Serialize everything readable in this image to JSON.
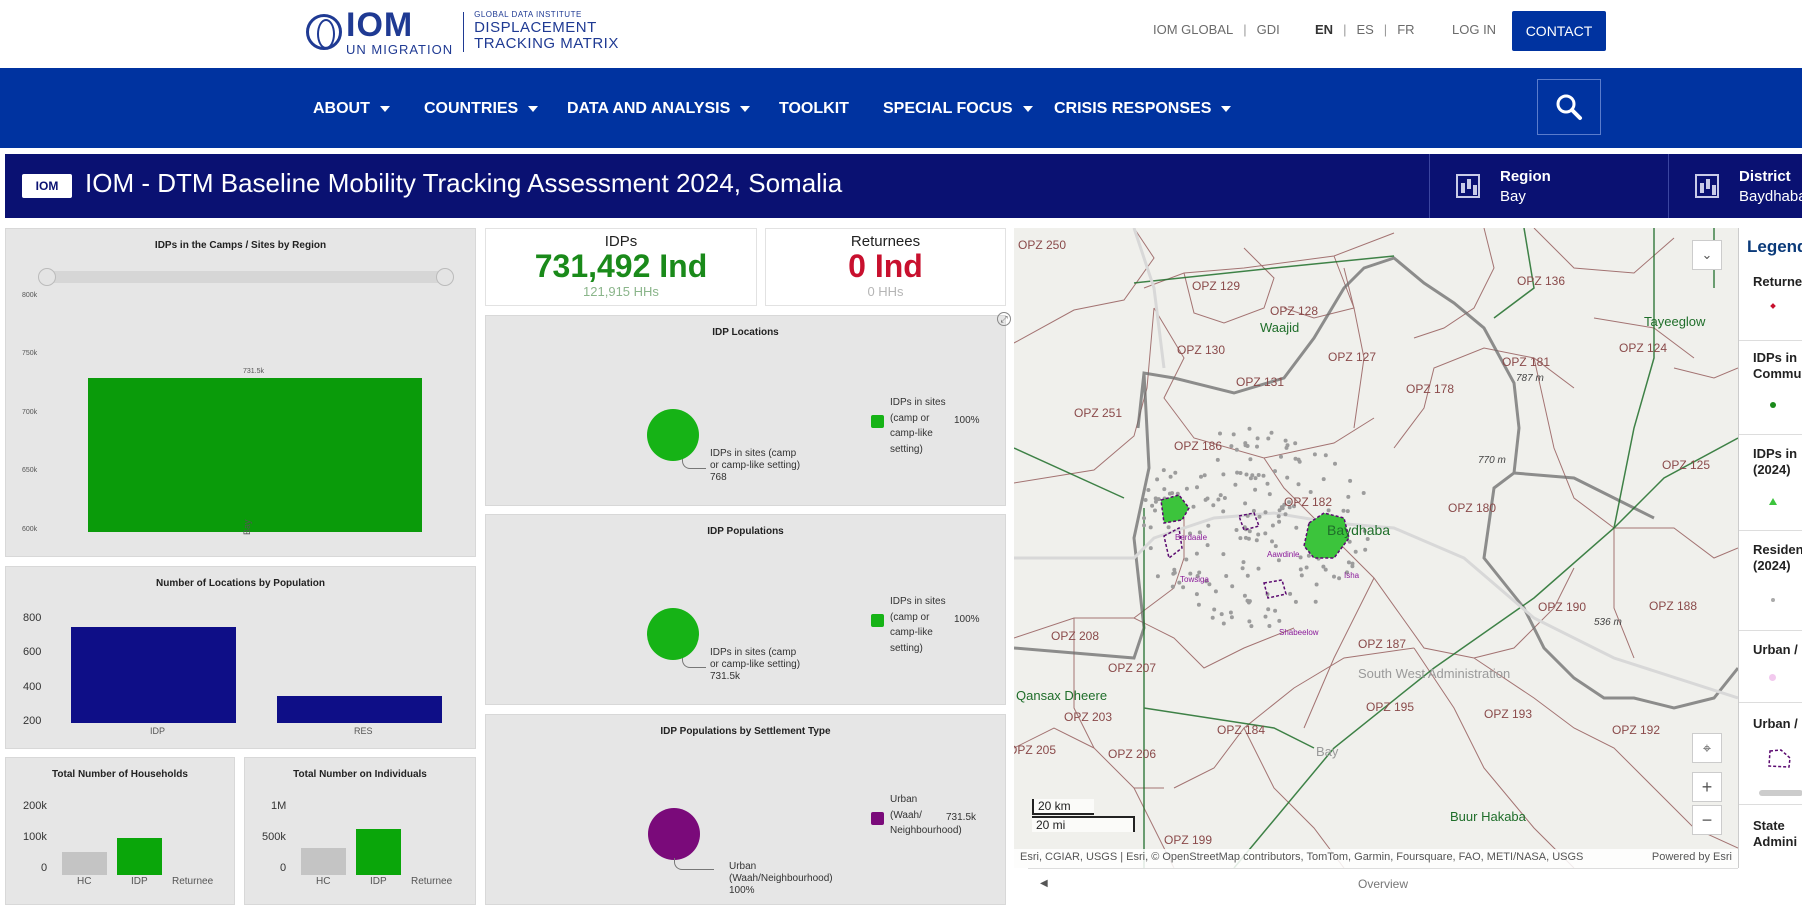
{
  "header": {
    "logo_iom": "IOM",
    "logo_un": "UN MIGRATION",
    "logo_gdi": "GLOBAL DATA INSTITUTE",
    "logo_dtm_line1": "DISPLACEMENT",
    "logo_dtm_line2": "TRACKING MATRIX",
    "links": {
      "iom_global": "IOM GLOBAL",
      "gdi": "GDI",
      "sep": "|"
    },
    "languages": {
      "en": "EN",
      "es": "ES",
      "fr": "FR"
    },
    "login": "LOG IN",
    "contact": "CONTACT"
  },
  "nav": {
    "items": [
      "ABOUT",
      "COUNTRIES",
      "DATA AND ANALYSIS",
      "TOOLKIT",
      "SPECIAL FOCUS",
      "CRISIS RESPONSES"
    ],
    "search_icon": "search-icon"
  },
  "dashboard": {
    "logo": "IOM",
    "title": "IOM - DTM Baseline Mobility Tracking Assessment 2024, Somalia",
    "filters": [
      {
        "label": "Region",
        "value": "Bay"
      },
      {
        "label": "District",
        "value": "Baydhaba"
      }
    ]
  },
  "kpis": {
    "idps": {
      "label": "IDPs",
      "value": "731,492 Ind",
      "sub": "121,915 HHs",
      "color": "#1a8a1a"
    },
    "returnees": {
      "label": "Returnees",
      "value": "0 Ind",
      "sub": "0 HHs",
      "color": "#c8102e"
    }
  },
  "charts": {
    "camps_by_region": {
      "title": "IDPs in the Camps / Sites by Region",
      "type": "bar",
      "categories": [
        "Bay"
      ],
      "values": [
        731.5
      ],
      "data_label": "731.5k",
      "yticks": [
        "800k",
        "750k",
        "700k",
        "650k",
        "600k"
      ],
      "color": "#0a9b0a"
    },
    "locations_by_population": {
      "title": "Number of Locations by Population",
      "type": "bar",
      "categories": [
        "IDP",
        "RES"
      ],
      "values": [
        768,
        351
      ],
      "yticks": [
        "800",
        "600",
        "400",
        "200"
      ],
      "color": "#0e0e87"
    },
    "households": {
      "title": "Total Number of Households",
      "type": "bar",
      "categories": [
        "HC",
        "IDP",
        "Returnee"
      ],
      "values": [
        73000,
        121915,
        0
      ],
      "yticks": [
        "200k",
        "100k",
        "0"
      ]
    },
    "individuals": {
      "title": "Total Number on Individuals",
      "type": "bar",
      "categories": [
        "HC",
        "IDP",
        "Returnee"
      ],
      "values": [
        430000,
        731492,
        0
      ],
      "yticks": [
        "1M",
        "500k",
        "0"
      ]
    },
    "idp_locations": {
      "title": "IDP Locations",
      "slice_label": "IDPs in sites (camp or camp-like setting) 768",
      "legend_label": "IDPs in sites (camp or camp-like setting)",
      "legend_value": "100%",
      "color": "#16b316"
    },
    "idp_populations": {
      "title": "IDP Populations",
      "slice_label": "IDPs in sites (camp or camp-like setting) 731.5k",
      "legend_label": "IDPs in sites (camp or camp-like setting)",
      "legend_value": "100%",
      "color": "#16b316"
    },
    "idp_by_settlement": {
      "title": "IDP Populations by Settlement Type",
      "slice_label": "Urban (Waah/Neighbourhood) 100%",
      "legend_label": "Urban (Waah/ Neighbourhood)",
      "legend_value": "731.5k",
      "color": "#7a0a7a"
    }
  },
  "chart_data": [
    {
      "type": "bar",
      "title": "IDPs in the Camps / Sites by Region",
      "categories": [
        "Bay"
      ],
      "values": [
        731500
      ],
      "ylim": [
        600000,
        800000
      ]
    },
    {
      "type": "bar",
      "title": "Number of Locations by Population",
      "categories": [
        "IDP",
        "RES"
      ],
      "values": [
        768,
        351
      ],
      "ylim": [
        200,
        800
      ]
    },
    {
      "type": "bar",
      "title": "Total Number of Households",
      "categories": [
        "HC",
        "IDP",
        "Returnee"
      ],
      "values": [
        73000,
        121915,
        0
      ],
      "ylim": [
        0,
        200000
      ]
    },
    {
      "type": "bar",
      "title": "Total Number on Individuals",
      "categories": [
        "HC",
        "IDP",
        "Returnee"
      ],
      "values": [
        430000,
        731492,
        0
      ],
      "ylim": [
        0,
        1000000
      ]
    },
    {
      "type": "pie",
      "title": "IDP Locations",
      "categories": [
        "IDPs in sites (camp or camp-like setting)"
      ],
      "values": [
        768
      ]
    },
    {
      "type": "pie",
      "title": "IDP Populations",
      "categories": [
        "IDPs in sites (camp or camp-like setting)"
      ],
      "values": [
        731500
      ]
    },
    {
      "type": "pie",
      "title": "IDP Populations by Settlement Type",
      "categories": [
        "Urban (Waah/Neighbourhood)"
      ],
      "values": [
        731500
      ]
    }
  ],
  "map": {
    "labels": [
      "OPZ 250",
      "OPZ 129",
      "OPZ 128",
      "Waajid",
      "OPZ 130",
      "OPZ 127",
      "OPZ 131",
      "OPZ 136",
      "Tayeeglow",
      "OPZ 124",
      "OPZ 181",
      "787 m",
      "OPZ 178",
      "OPZ 251",
      "OPZ 186",
      "770 m",
      "OPZ 125",
      "OPZ 182",
      "Baydhaba",
      "OPZ 180",
      "OPZ 190",
      "536 m",
      "OPZ 188",
      "OPZ 208",
      "OPZ 207",
      "OPZ 187",
      "South West Administration",
      "Qansax Dheere",
      "OPZ 203",
      "OPZ 195",
      "OPZ 193",
      "OPZ 192",
      "OPZ 184",
      "OPZ 205",
      "OPZ 206",
      "Bay",
      "Buur Hakaba",
      "OPZ 199"
    ],
    "site_labels": [
      "Berdaale",
      "Towsiga",
      "Aawdinle",
      "Shabeelow",
      "Isha"
    ],
    "scale_km": "20 km",
    "scale_mi": "20 mi",
    "attribution": "Esri, CGIAR, USGS | Esri, © OpenStreetMap contributors, TomTom, Garmin, Foursquare, FAO, METI/NASA, USGS",
    "powered_by": "Powered by Esri",
    "overview": "Overview"
  },
  "legend": {
    "title": "Legend",
    "items": [
      "Returne",
      "IDPs in Commu",
      "IDPs in (2024)",
      "Residen (2024)",
      "Urban /",
      "Urban /",
      "State Admini"
    ]
  }
}
